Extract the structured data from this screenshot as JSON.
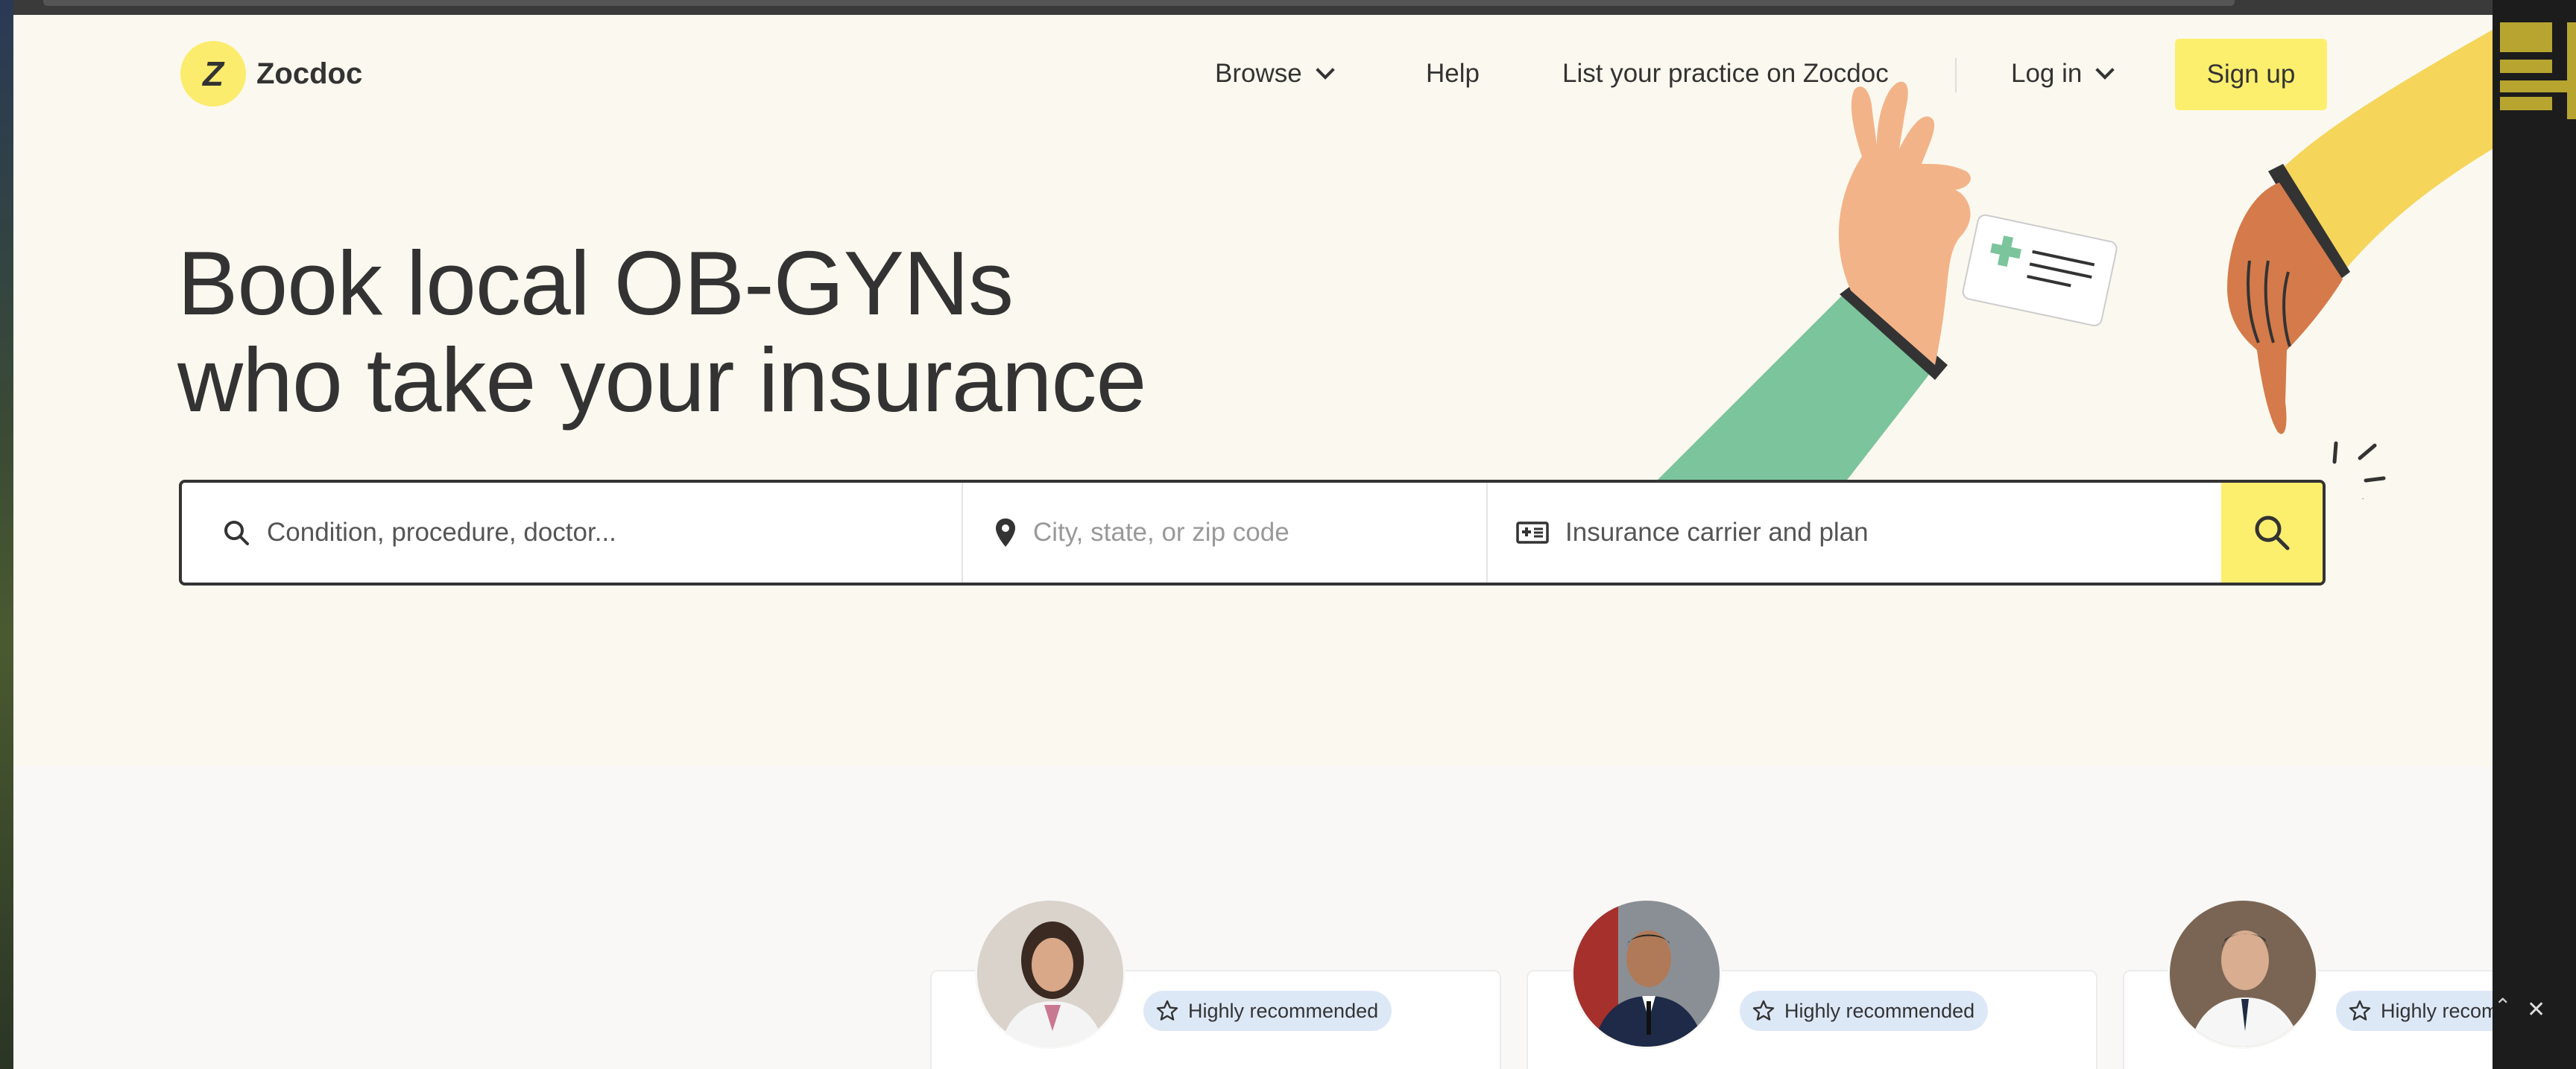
{
  "brand": {
    "logo_glyph": "Z",
    "name": "Zocdoc"
  },
  "nav": {
    "browse": "Browse",
    "help": "Help",
    "list_practice": "List your practice on Zocdoc",
    "login": "Log in",
    "signup": "Sign up"
  },
  "hero": {
    "line1": "Book local OB-GYNs",
    "line2": "who take your insurance"
  },
  "search": {
    "condition_placeholder": "Condition, procedure, doctor...",
    "location_placeholder": "City, state, or zip code",
    "insurance_placeholder": "Insurance carrier and plan"
  },
  "cards": [
    {
      "badge": "Highly recommended"
    },
    {
      "badge": "Highly recommended"
    },
    {
      "badge": "Highly recom"
    }
  ],
  "colors": {
    "accent": "#fdef6e",
    "hero_bg": "#fbf9ef",
    "text": "#333333",
    "badge_bg": "#dde8f7"
  }
}
